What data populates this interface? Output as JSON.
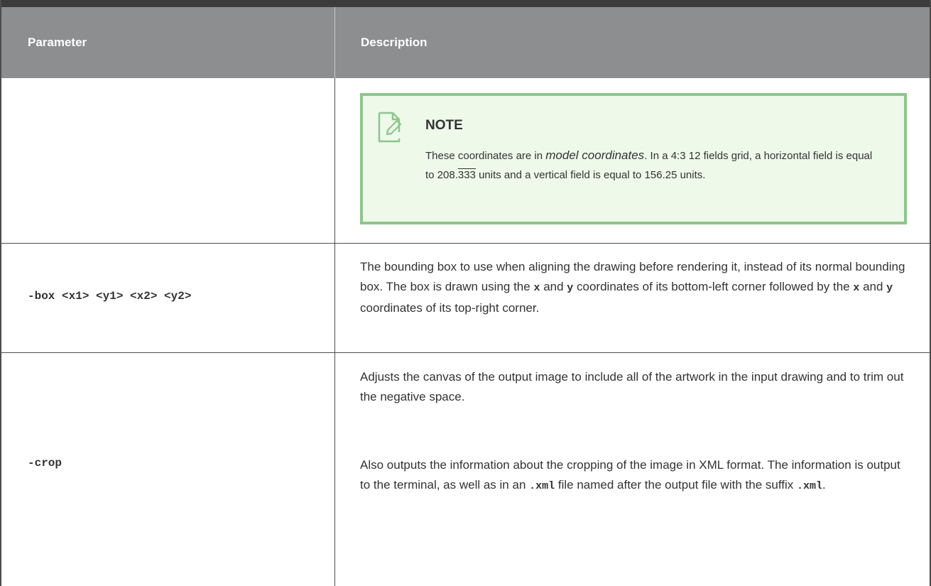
{
  "header": {
    "param_label": "Parameter",
    "desc_label": "Description"
  },
  "note": {
    "title": "NOTE",
    "icon": "note-pencil-icon",
    "text_1": "These coordinates are in ",
    "text_italic": "model coordinates",
    "text_2": ". In a 4:3 12 fields grid, a horizontal field is equal to 208.",
    "text_repeat": "333",
    "text_3": " units and a vertical field is equal to 156.25 units."
  },
  "rows": [
    {
      "param": "-box <x1> <y1> <x2> <y2>",
      "desc_1": "The bounding box to use when aligning the drawing before rendering it, instead of its normal bounding box. The box is drawn using the ",
      "code_x1": "x",
      "desc_2": " and ",
      "code_y1": "y",
      "desc_3": " coordinates of its bottom-left corner followed by the ",
      "code_x2": "x",
      "desc_4": " and ",
      "code_y2": "y",
      "desc_5": " coordinates of its top-right corner."
    },
    {
      "param": "-crop",
      "para1": "Adjusts the canvas of the output image to include all of the artwork in the input drawing and to trim out the negative space.",
      "para2_1": "Also outputs the information about the cropping of the image in XML format. The information is output to the terminal, as well as in an ",
      "code_xml1": ".xml",
      "para2_2": " file named after the output file with the suffix ",
      "code_xml2": ".xml",
      "para2_3": "."
    }
  ],
  "colors": {
    "header_bg": "#8d8e90",
    "note_bg": "#eef9ea",
    "note_border": "#8dc68a",
    "border": "#4c4c4c"
  }
}
